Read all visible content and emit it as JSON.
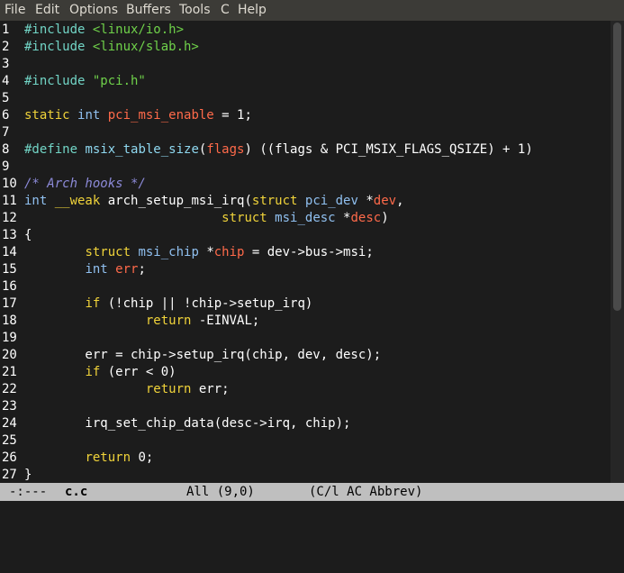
{
  "menubar": {
    "items": [
      "File",
      "Edit",
      "Options",
      "Buffers",
      "Tools",
      "C",
      "Help"
    ]
  },
  "editor": {
    "lines": [
      {
        "num": "1",
        "tokens": [
          [
            "pp",
            "#include "
          ],
          [
            "str",
            "<linux/io.h>"
          ]
        ]
      },
      {
        "num": "2",
        "tokens": [
          [
            "pp",
            "#include "
          ],
          [
            "str",
            "<linux/slab.h>"
          ]
        ]
      },
      {
        "num": "3",
        "tokens": []
      },
      {
        "num": "4",
        "tokens": [
          [
            "pp",
            "#include "
          ],
          [
            "str",
            "\"pci.h\""
          ]
        ]
      },
      {
        "num": "5",
        "tokens": []
      },
      {
        "num": "6",
        "tokens": [
          [
            "kw",
            "static "
          ],
          [
            "ty",
            "int "
          ],
          [
            "var",
            "pci_msi_enable"
          ],
          [
            "",
            " = 1;"
          ]
        ]
      },
      {
        "num": "7",
        "tokens": []
      },
      {
        "num": "8",
        "tokens": [
          [
            "pp",
            "#define "
          ],
          [
            "fn",
            "msix_table_size"
          ],
          [
            "",
            "("
          ],
          [
            "var",
            "flags"
          ],
          [
            "",
            ") ((flags & PCI_MSIX_FLAGS_QSIZE) + 1)"
          ]
        ]
      },
      {
        "num": "9",
        "tokens": []
      },
      {
        "num": "10",
        "tokens": [
          [
            "cm",
            "/* Arch hooks */"
          ]
        ]
      },
      {
        "num": "11",
        "tokens": [
          [
            "ty",
            "int "
          ],
          [
            "kw",
            "__weak "
          ],
          [
            "",
            "arch_setup_msi_irq("
          ],
          [
            "kw",
            "struct "
          ],
          [
            "ty",
            "pci_dev "
          ],
          [
            "",
            "*"
          ],
          [
            "var",
            "dev"
          ],
          [
            "",
            ","
          ]
        ]
      },
      {
        "num": "12",
        "tokens": [
          [
            "",
            "                          "
          ],
          [
            "kw",
            "struct "
          ],
          [
            "ty",
            "msi_desc "
          ],
          [
            "",
            "*"
          ],
          [
            "var",
            "desc"
          ],
          [
            "",
            ")"
          ]
        ]
      },
      {
        "num": "13",
        "tokens": [
          [
            "",
            "{"
          ]
        ]
      },
      {
        "num": "14",
        "tokens": [
          [
            "",
            "        "
          ],
          [
            "kw",
            "struct "
          ],
          [
            "ty",
            "msi_chip "
          ],
          [
            "",
            "*"
          ],
          [
            "var",
            "chip"
          ],
          [
            "",
            " = dev->bus->msi;"
          ]
        ]
      },
      {
        "num": "15",
        "tokens": [
          [
            "",
            "        "
          ],
          [
            "ty",
            "int "
          ],
          [
            "var",
            "err"
          ],
          [
            "",
            ";"
          ]
        ]
      },
      {
        "num": "16",
        "tokens": []
      },
      {
        "num": "17",
        "tokens": [
          [
            "",
            "        "
          ],
          [
            "kw",
            "if"
          ],
          [
            "",
            " (!chip || !chip->setup_irq)"
          ]
        ]
      },
      {
        "num": "18",
        "tokens": [
          [
            "",
            "                "
          ],
          [
            "kw",
            "return"
          ],
          [
            "",
            " -EINVAL;"
          ]
        ]
      },
      {
        "num": "19",
        "tokens": []
      },
      {
        "num": "20",
        "tokens": [
          [
            "",
            "        err = chip->setup_irq(chip, dev, desc);"
          ]
        ]
      },
      {
        "num": "21",
        "tokens": [
          [
            "",
            "        "
          ],
          [
            "kw",
            "if"
          ],
          [
            "",
            " (err < 0)"
          ]
        ]
      },
      {
        "num": "22",
        "tokens": [
          [
            "",
            "                "
          ],
          [
            "kw",
            "return"
          ],
          [
            "",
            " err;"
          ]
        ]
      },
      {
        "num": "23",
        "tokens": []
      },
      {
        "num": "24",
        "tokens": [
          [
            "",
            "        irq_set_chip_data(desc->irq, chip);"
          ]
        ]
      },
      {
        "num": "25",
        "tokens": []
      },
      {
        "num": "26",
        "tokens": [
          [
            "",
            "        "
          ],
          [
            "kw",
            "return"
          ],
          [
            "",
            " 0;"
          ]
        ]
      },
      {
        "num": "27",
        "tokens": [
          [
            "",
            "}"
          ]
        ]
      }
    ]
  },
  "modeline": {
    "status": "-:---",
    "buffer_name": "c.c",
    "position": "All (9,0)",
    "modes": "(C/l AC Abbrev)"
  },
  "colors": {
    "background": "#1c1c1c",
    "menubar": "#3c3b37",
    "modeline": "#bfbfbf",
    "preprocessor": "#72d5c6",
    "string": "#6fd14a",
    "keyword": "#f0d33a",
    "type": "#90c0f0",
    "variable": "#ff6a4a",
    "comment": "#8c8ad8"
  }
}
